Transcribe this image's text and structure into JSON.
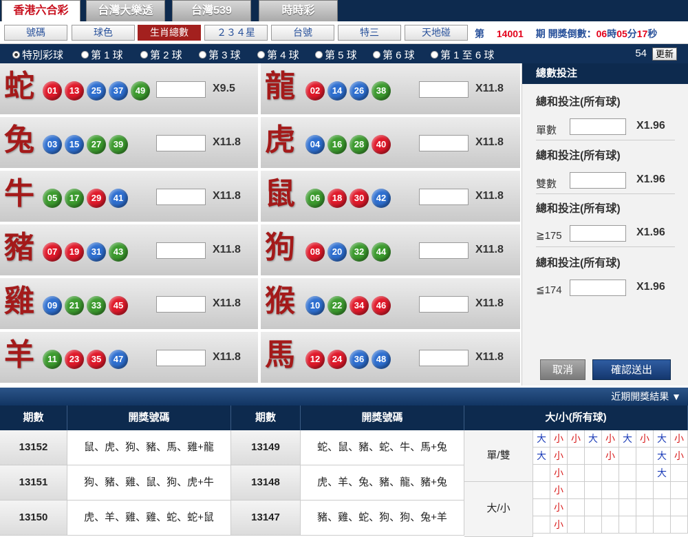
{
  "game_tabs": [
    {
      "label": "香港六合彩",
      "active": true
    },
    {
      "label": "台灣大樂透",
      "active": false
    },
    {
      "label": "台灣539",
      "active": false
    },
    {
      "label": "時時彩",
      "active": false
    }
  ],
  "sub_tabs": [
    {
      "label": "號碼",
      "active": false
    },
    {
      "label": "球色",
      "active": false
    },
    {
      "label": "生肖總數",
      "active": true
    },
    {
      "label": "２３４星",
      "active": false
    },
    {
      "label": "台號",
      "active": false
    },
    {
      "label": "特三",
      "active": false
    },
    {
      "label": "天地碰",
      "active": false
    }
  ],
  "period": {
    "prefix": "第",
    "number": "14001",
    "suffix": "期 開獎倒數：",
    "hours": "06",
    "h_label": "時",
    "minutes": "05",
    "m_label": "分",
    "seconds": "17",
    "s_label": "秒"
  },
  "ball_options": [
    {
      "label": "特別彩球",
      "selected": true
    },
    {
      "label": "第 1 球",
      "selected": false
    },
    {
      "label": "第 2 球",
      "selected": false
    },
    {
      "label": "第 3 球",
      "selected": false
    },
    {
      "label": "第 4 球",
      "selected": false
    },
    {
      "label": "第 5 球",
      "selected": false
    },
    {
      "label": "第 6 球",
      "selected": false
    },
    {
      "label": "第 1 至 6 球",
      "selected": false
    }
  ],
  "countdown": "54",
  "refresh_label": "更新",
  "zodiacs": [
    {
      "name": "蛇",
      "odds": "X9.5",
      "balls": [
        [
          "01",
          "r"
        ],
        [
          "13",
          "r"
        ],
        [
          "25",
          "b"
        ],
        [
          "37",
          "b"
        ],
        [
          "49",
          "g"
        ]
      ]
    },
    {
      "name": "龍",
      "odds": "X11.8",
      "balls": [
        [
          "02",
          "r"
        ],
        [
          "14",
          "b"
        ],
        [
          "26",
          "b"
        ],
        [
          "38",
          "g"
        ]
      ]
    },
    {
      "name": "兔",
      "odds": "X11.8",
      "balls": [
        [
          "03",
          "b"
        ],
        [
          "15",
          "b"
        ],
        [
          "27",
          "g"
        ],
        [
          "39",
          "g"
        ]
      ]
    },
    {
      "name": "虎",
      "odds": "X11.8",
      "balls": [
        [
          "04",
          "b"
        ],
        [
          "16",
          "g"
        ],
        [
          "28",
          "g"
        ],
        [
          "40",
          "r"
        ]
      ]
    },
    {
      "name": "牛",
      "odds": "X11.8",
      "balls": [
        [
          "05",
          "g"
        ],
        [
          "17",
          "g"
        ],
        [
          "29",
          "r"
        ],
        [
          "41",
          "b"
        ]
      ]
    },
    {
      "name": "鼠",
      "odds": "X11.8",
      "balls": [
        [
          "06",
          "g"
        ],
        [
          "18",
          "r"
        ],
        [
          "30",
          "r"
        ],
        [
          "42",
          "b"
        ]
      ]
    },
    {
      "name": "豬",
      "odds": "X11.8",
      "balls": [
        [
          "07",
          "r"
        ],
        [
          "19",
          "r"
        ],
        [
          "31",
          "b"
        ],
        [
          "43",
          "g"
        ]
      ]
    },
    {
      "name": "狗",
      "odds": "X11.8",
      "balls": [
        [
          "08",
          "r"
        ],
        [
          "20",
          "b"
        ],
        [
          "32",
          "g"
        ],
        [
          "44",
          "g"
        ]
      ]
    },
    {
      "name": "雞",
      "odds": "X11.8",
      "balls": [
        [
          "09",
          "b"
        ],
        [
          "21",
          "g"
        ],
        [
          "33",
          "g"
        ],
        [
          "45",
          "r"
        ]
      ]
    },
    {
      "name": "猴",
      "odds": "X11.8",
      "balls": [
        [
          "10",
          "b"
        ],
        [
          "22",
          "g"
        ],
        [
          "34",
          "r"
        ],
        [
          "46",
          "r"
        ]
      ]
    },
    {
      "name": "羊",
      "odds": "X11.8",
      "balls": [
        [
          "11",
          "g"
        ],
        [
          "23",
          "r"
        ],
        [
          "35",
          "r"
        ],
        [
          "47",
          "b"
        ]
      ]
    },
    {
      "name": "馬",
      "odds": "X11.8",
      "balls": [
        [
          "12",
          "r"
        ],
        [
          "24",
          "r"
        ],
        [
          "36",
          "b"
        ],
        [
          "48",
          "b"
        ]
      ]
    }
  ],
  "sum_panel": {
    "title": "總數投注",
    "items": [
      {
        "head": "總和投注(所有球)",
        "label": "單數",
        "odds": "X1.96"
      },
      {
        "head": "總和投注(所有球)",
        "label": "雙數",
        "odds": "X1.96"
      },
      {
        "head": "總和投注(所有球)",
        "label": "≧175",
        "odds": "X1.96"
      },
      {
        "head": "總和投注(所有球)",
        "label": "≦174",
        "odds": "X1.96"
      }
    ],
    "cancel_label": "取消",
    "confirm_label": "確認送出"
  },
  "recent_label": "近期開獎結果 ▼",
  "results": {
    "headers": [
      "期數",
      "開獎號碼",
      "期數",
      "開獎號碼",
      "大/小(所有球)"
    ],
    "rows": [
      {
        "p1": "13152",
        "r1": "鼠、虎、狗、豬、馬、雞+龍",
        "p2": "13149",
        "r2": "蛇、鼠、豬、蛇、牛、馬+兔"
      },
      {
        "p1": "13151",
        "r1": "狗、豬、雞、鼠、狗、虎+牛",
        "p2": "13148",
        "r2": "虎、羊、兔、豬、龍、豬+兔"
      },
      {
        "p1": "13150",
        "r1": "虎、羊、雞、雞、蛇、蛇+鼠",
        "p2": "13147",
        "r2": "豬、雞、蛇、狗、狗、兔+羊"
      }
    ],
    "trend_labels": [
      "單/雙",
      "大/小"
    ],
    "trend_rows": [
      [
        "大",
        "小",
        "小",
        "大",
        "小",
        "大",
        "小",
        "大",
        "小"
      ],
      [
        "大",
        "小",
        "",
        "",
        "小",
        "",
        "",
        "大",
        "小"
      ],
      [
        "",
        "小",
        "",
        "",
        "",
        "",
        "",
        "大",
        ""
      ],
      [
        "",
        "小",
        "",
        "",
        "",
        "",
        "",
        "",
        ""
      ],
      [
        "",
        "小",
        "",
        "",
        "",
        "",
        "",
        "",
        ""
      ],
      [
        "",
        "小",
        "",
        "",
        "",
        "",
        "",
        "",
        ""
      ]
    ]
  }
}
